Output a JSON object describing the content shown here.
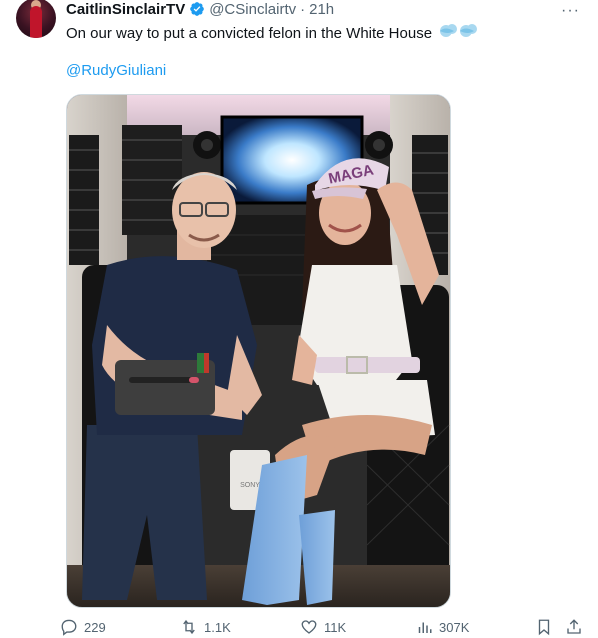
{
  "tweet": {
    "author_name": "CaitlinSinclairTV",
    "handle": "@CSinclairtv",
    "separator": "·",
    "time": "21h",
    "more_label": "···",
    "text": "On our way to put a convicted felon in the White House",
    "emoji": "dash-symbol-emoji",
    "mention": "@RudyGiuliani"
  },
  "media": {
    "cap_text": "MAGA",
    "box_text": "SONY"
  },
  "actions": {
    "replies": "229",
    "reposts": "1.1K",
    "likes": "11K",
    "views": "307K"
  },
  "colors": {
    "accent": "#1d9bf0",
    "text": "#0f1419",
    "muted": "#536471",
    "border": "#cfd9de"
  },
  "icons": [
    "reply-icon",
    "repost-icon",
    "like-icon",
    "views-icon",
    "bookmark-icon",
    "share-icon",
    "verified-badge-icon",
    "more-icon"
  ]
}
